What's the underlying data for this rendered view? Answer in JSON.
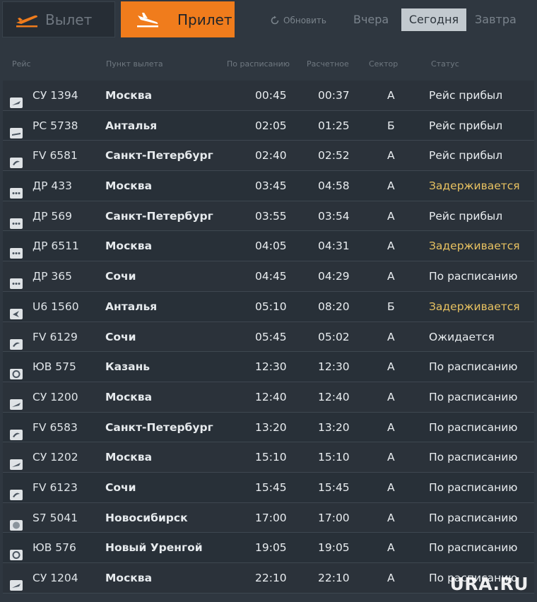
{
  "tabs": {
    "departure": "Вылет",
    "arrival": "Прилет"
  },
  "refresh_label": "Обновить",
  "days": {
    "yesterday": "Вчера",
    "today": "Сегодня",
    "tomorrow": "Завтра"
  },
  "columns": {
    "flight": "Рейс",
    "origin": "Пункт вылета",
    "scheduled": "По расписанию",
    "estimated": "Расчетное",
    "sector": "Сектор",
    "status": "Статус"
  },
  "colors": {
    "accent": "#f07c1c",
    "delay": "#e8c261",
    "background": "#2f3740"
  },
  "flights": [
    {
      "logo": "aeroflot",
      "flight": "СУ 1394",
      "origin": "Москва",
      "scheduled": "00:45",
      "estimated": "00:37",
      "sector": "А",
      "status": "Рейс прибыл",
      "delayed": false
    },
    {
      "logo": "generic-plane",
      "flight": "РС 5738",
      "origin": "Анталья",
      "scheduled": "02:05",
      "estimated": "01:25",
      "sector": "Б",
      "status": "Рейс прибыл",
      "delayed": false
    },
    {
      "logo": "pobeda-swirl",
      "flight": "FV 6581",
      "origin": "Санкт-Петербург",
      "scheduled": "02:40",
      "estimated": "02:52",
      "sector": "А",
      "status": "Рейс прибыл",
      "delayed": false
    },
    {
      "logo": "dots",
      "flight": "ДР 433",
      "origin": "Москва",
      "scheduled": "03:45",
      "estimated": "04:58",
      "sector": "А",
      "status": "Задерживается",
      "delayed": true
    },
    {
      "logo": "dots",
      "flight": "ДР 569",
      "origin": "Санкт-Петербург",
      "scheduled": "03:55",
      "estimated": "03:54",
      "sector": "А",
      "status": "Рейс прибыл",
      "delayed": false
    },
    {
      "logo": "dots",
      "flight": "ДР 6511",
      "origin": "Москва",
      "scheduled": "04:05",
      "estimated": "04:31",
      "sector": "А",
      "status": "Задерживается",
      "delayed": true
    },
    {
      "logo": "dots",
      "flight": "ДР 365",
      "origin": "Сочи",
      "scheduled": "04:45",
      "estimated": "04:29",
      "sector": "А",
      "status": "По расписанию",
      "delayed": false
    },
    {
      "logo": "ural-arrow",
      "flight": "U6 1560",
      "origin": "Анталья",
      "scheduled": "05:10",
      "estimated": "08:20",
      "sector": "Б",
      "status": "Задерживается",
      "delayed": true
    },
    {
      "logo": "pobeda-swirl",
      "flight": "FV 6129",
      "origin": "Сочи",
      "scheduled": "05:45",
      "estimated": "05:02",
      "sector": "А",
      "status": "Ожидается",
      "delayed": false
    },
    {
      "logo": "utair-circle",
      "flight": "ЮВ 575",
      "origin": "Казань",
      "scheduled": "12:30",
      "estimated": "12:30",
      "sector": "А",
      "status": "По расписанию",
      "delayed": false
    },
    {
      "logo": "aeroflot",
      "flight": "СУ 1200",
      "origin": "Москва",
      "scheduled": "12:40",
      "estimated": "12:40",
      "sector": "А",
      "status": "По расписанию",
      "delayed": false
    },
    {
      "logo": "pobeda-swirl",
      "flight": "FV 6583",
      "origin": "Санкт-Петербург",
      "scheduled": "13:20",
      "estimated": "13:20",
      "sector": "А",
      "status": "По расписанию",
      "delayed": false
    },
    {
      "logo": "aeroflot",
      "flight": "СУ 1202",
      "origin": "Москва",
      "scheduled": "15:10",
      "estimated": "15:10",
      "sector": "А",
      "status": "По расписанию",
      "delayed": false
    },
    {
      "logo": "pobeda-swirl",
      "flight": "FV 6123",
      "origin": "Сочи",
      "scheduled": "15:45",
      "estimated": "15:45",
      "sector": "А",
      "status": "По расписанию",
      "delayed": false
    },
    {
      "logo": "s7-circle",
      "flight": "S7 5041",
      "origin": "Новосибирск",
      "scheduled": "17:00",
      "estimated": "17:00",
      "sector": "А",
      "status": "По расписанию",
      "delayed": false
    },
    {
      "logo": "utair-circle",
      "flight": "ЮВ 576",
      "origin": "Новый Уренгой",
      "scheduled": "19:05",
      "estimated": "19:05",
      "sector": "А",
      "status": "По расписанию",
      "delayed": false
    },
    {
      "logo": "aeroflot",
      "flight": "СУ 1204",
      "origin": "Москва",
      "scheduled": "22:10",
      "estimated": "22:10",
      "sector": "А",
      "status": "По расписанию",
      "delayed": false
    }
  ],
  "watermark": "URA.RU"
}
